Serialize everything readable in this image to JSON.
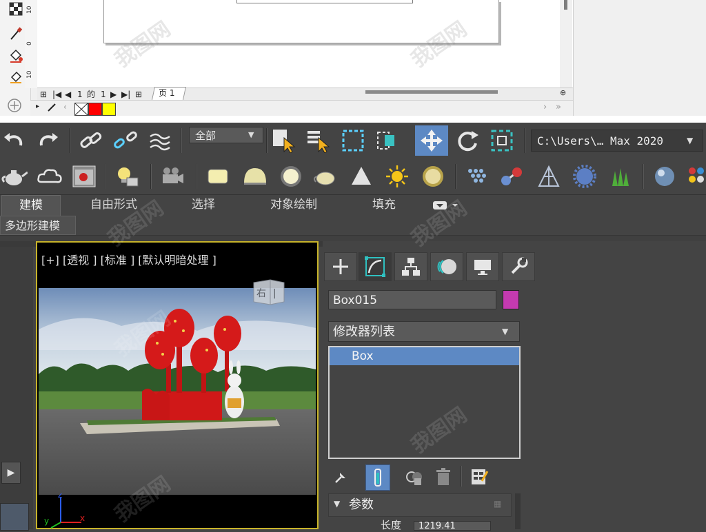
{
  "corel": {
    "ruler_labels": [
      "10",
      "0",
      "10"
    ],
    "page_nav": {
      "current": "1",
      "of_label": "的",
      "total": "1"
    },
    "page_tab": "页 1",
    "palette": [
      {
        "name": "none",
        "color": "#ffffff"
      },
      {
        "name": "red",
        "color": "#ff0000"
      },
      {
        "name": "yellow",
        "color": "#ffff00"
      }
    ]
  },
  "max": {
    "selection_filter": "全部",
    "project_path": "C:\\Users\\… Max 2020",
    "ribbon_tabs": [
      "建模",
      "自由形式",
      "选择",
      "对象绘制",
      "填充"
    ],
    "ribbon_subtab": "多边形建模",
    "viewport": {
      "label": "[+] [透视 ] [标准 ] [默认明暗处理 ]",
      "viewcube_text": "右",
      "axis_x": "x",
      "axis_y": "y",
      "axis_z": "z"
    },
    "command_panel": {
      "object_name": "Box015",
      "object_color": "#c43ab0",
      "modifier_list": "修改器列表",
      "stack_items": [
        "Box"
      ],
      "rollout_title": "参数",
      "length_label": "长度",
      "length_value": "1219.41"
    }
  },
  "watermark": "我图网"
}
